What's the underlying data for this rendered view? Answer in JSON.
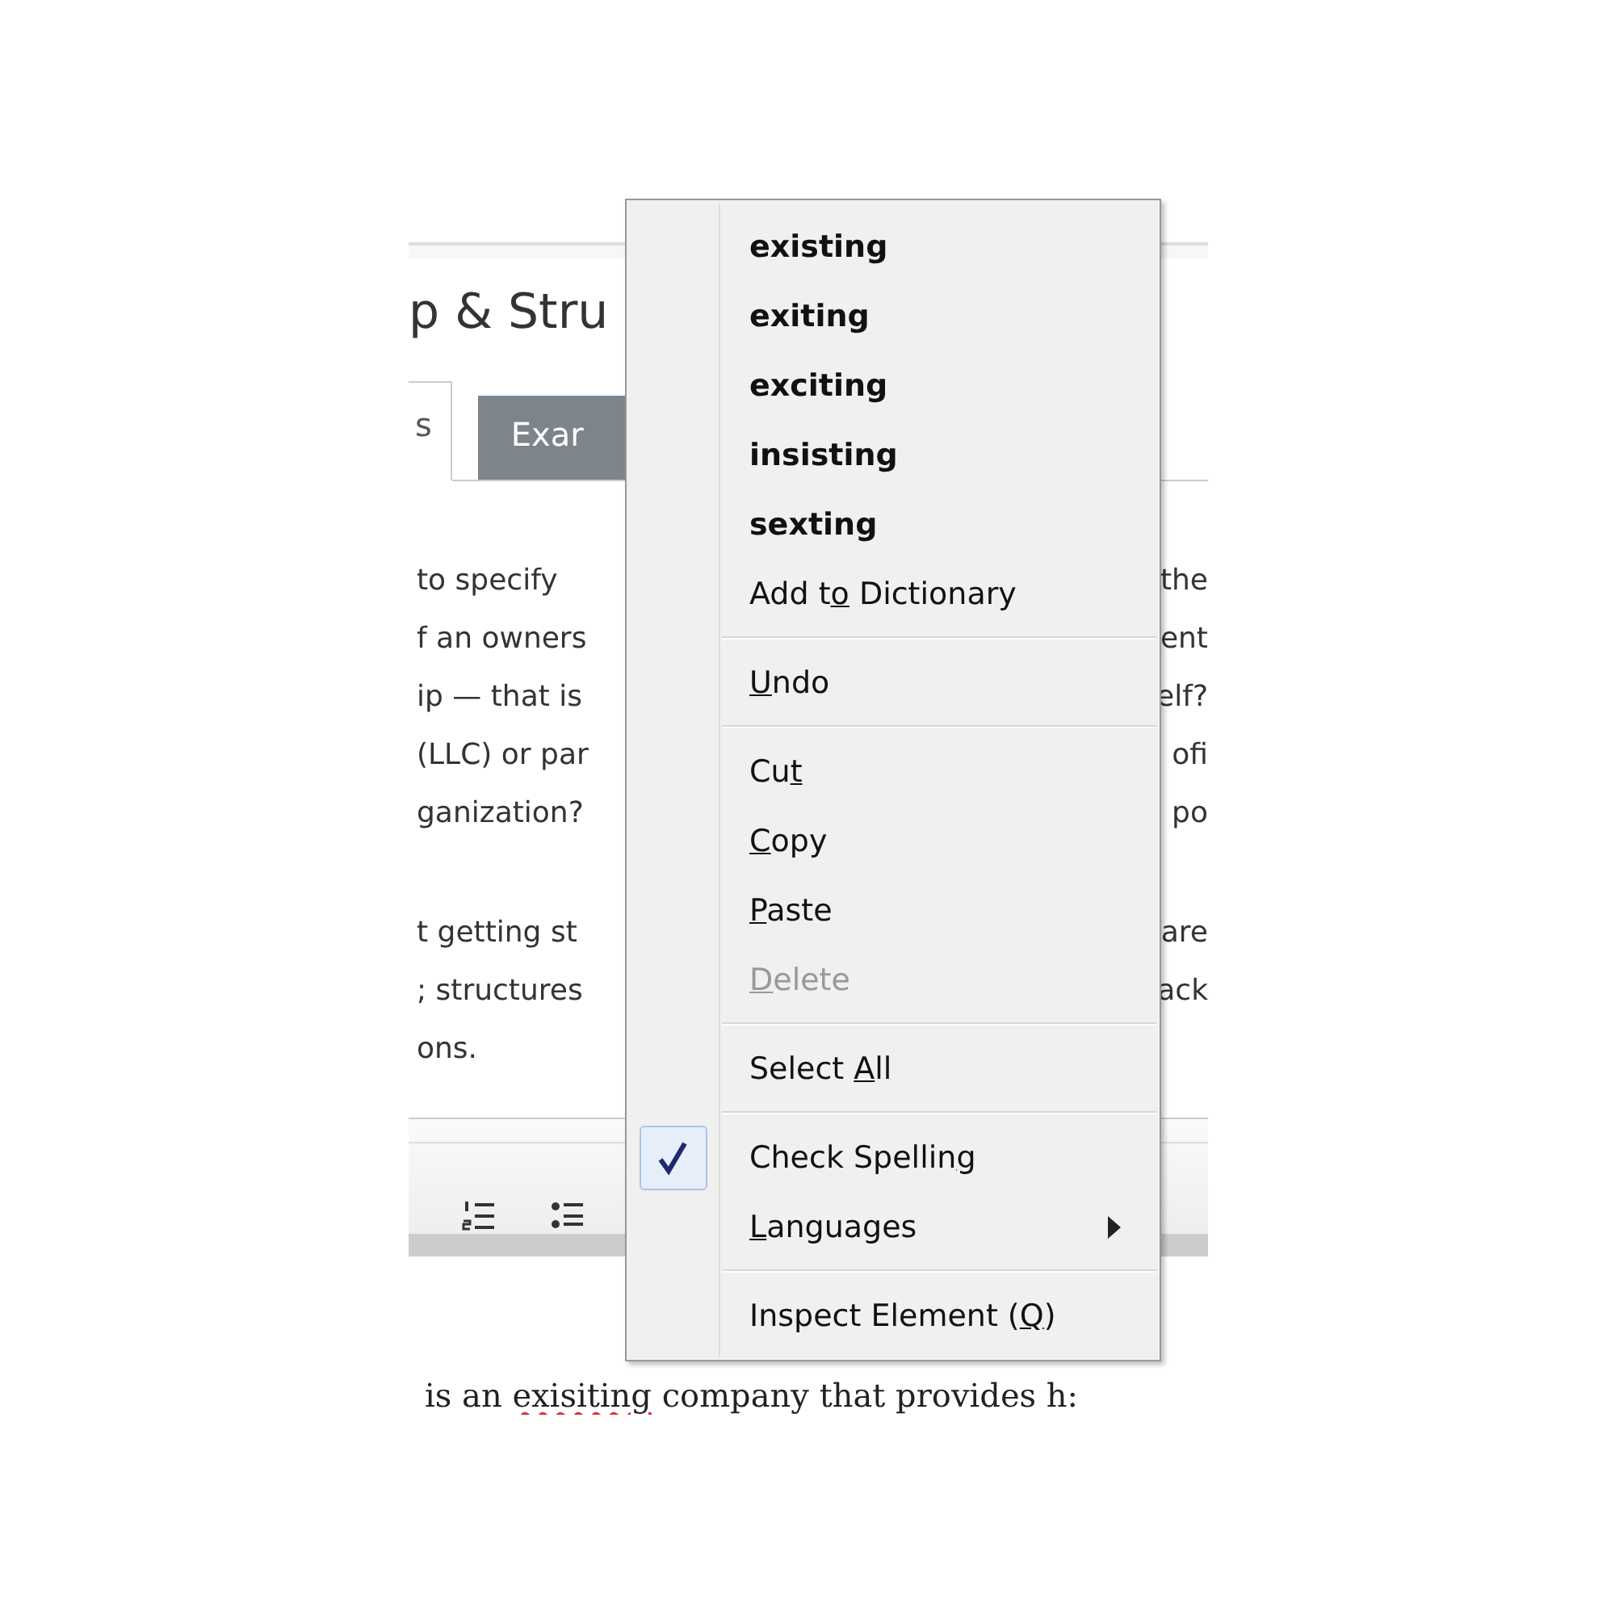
{
  "page": {
    "heading": "p & Stru",
    "tabs": [
      {
        "label": "s",
        "selected": true
      },
      {
        "label": "Exar",
        "selected": false
      }
    ],
    "paragraphs": [
      [
        {
          "left": "to specify",
          "right": "the"
        },
        {
          "left": "f an owners",
          "right": "ent"
        },
        {
          "left": "ip — that is",
          "right": "elf?"
        },
        {
          "left": "(LLC) or par",
          "right": "ofi"
        },
        {
          "left": "ganization?",
          "right": "po"
        }
      ],
      [
        {
          "left": "t getting st",
          "right": "are"
        },
        {
          "left": "; structures",
          "right": "ack"
        },
        {
          "left": "ons."
        }
      ]
    ],
    "toolbar": {
      "tools": [
        {
          "kind": "numbered-list"
        },
        {
          "kind": "bulleted-list"
        }
      ]
    },
    "editor_text": {
      "pre": "is an ",
      "misspelled": "exisiting",
      "post": " company that provides h:"
    }
  },
  "context_menu": {
    "items": [
      {
        "kind": "suggestion",
        "label": {
          "pre": "existing"
        },
        "disabled": false,
        "checked": false
      },
      {
        "kind": "suggestion",
        "label": {
          "pre": "exiting"
        },
        "disabled": false,
        "checked": false
      },
      {
        "kind": "suggestion",
        "label": {
          "pre": "exciting"
        },
        "disabled": false,
        "checked": false
      },
      {
        "kind": "suggestion",
        "label": {
          "pre": "insisting"
        },
        "disabled": false,
        "checked": false
      },
      {
        "kind": "suggestion",
        "label": {
          "pre": "sexting"
        },
        "disabled": false,
        "checked": false
      },
      {
        "kind": "command",
        "label": {
          "pre": "Add t",
          "key": "o",
          "post": " Dictionary"
        },
        "disabled": false,
        "checked": false
      },
      {
        "kind": "separator"
      },
      {
        "kind": "command",
        "label": {
          "key": "U",
          "post": "ndo"
        },
        "disabled": false,
        "checked": false
      },
      {
        "kind": "separator"
      },
      {
        "kind": "command",
        "label": {
          "pre": "Cu",
          "key": "t"
        },
        "disabled": false,
        "checked": false
      },
      {
        "kind": "command",
        "label": {
          "key": "C",
          "post": "opy"
        },
        "disabled": false,
        "checked": false
      },
      {
        "kind": "command",
        "label": {
          "key": "P",
          "post": "aste"
        },
        "disabled": false,
        "checked": false
      },
      {
        "kind": "command",
        "label": {
          "key": "D",
          "post": "elete"
        },
        "disabled": true,
        "checked": false
      },
      {
        "kind": "separator"
      },
      {
        "kind": "command",
        "label": {
          "pre": "Select ",
          "key": "A",
          "post": "ll"
        },
        "disabled": false,
        "checked": false
      },
      {
        "kind": "separator"
      },
      {
        "kind": "command",
        "label": {
          "pre": "Check Spellin",
          "key": "g"
        },
        "disabled": false,
        "checked": true
      },
      {
        "kind": "submenu",
        "label": {
          "key": "L",
          "post": "anguages"
        },
        "disabled": false,
        "checked": false
      },
      {
        "kind": "separator"
      },
      {
        "kind": "command",
        "label": {
          "pre": "Inspect Element (",
          "key": "Q",
          "post": ")"
        },
        "disabled": false,
        "checked": false
      }
    ]
  }
}
